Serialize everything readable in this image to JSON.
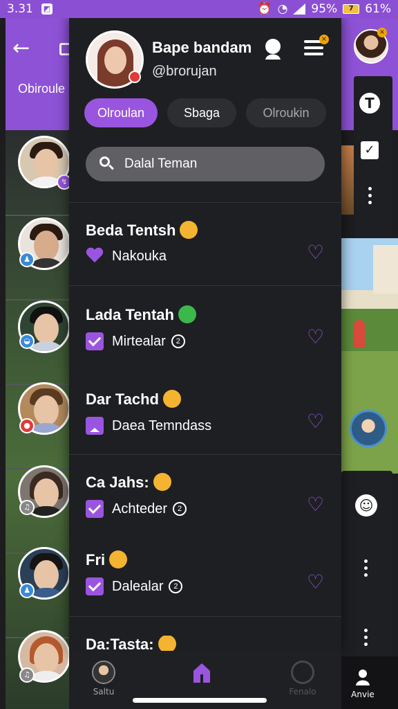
{
  "status": {
    "time": "3.31",
    "battery": "95%",
    "extra": "61%"
  },
  "background": {
    "tab_label": "Obiroule"
  },
  "profile": {
    "name": "Bape bandam",
    "handle": "@brorujan"
  },
  "tabs": [
    {
      "label": "Olroulan",
      "active": true
    },
    {
      "label": "Sbaga",
      "active": false
    },
    {
      "label": "Olroukin",
      "active": false
    }
  ],
  "search": {
    "placeholder": "Dalal Teman"
  },
  "contacts": [
    {
      "name": "Beda Tentsh",
      "status": "Nakouka",
      "indicator": "heart"
    },
    {
      "name": "Lada Tentah",
      "status": "Mirtealar",
      "indicator": "check",
      "extra": "2"
    },
    {
      "name": "Dar Tachd",
      "status": "Daea Temndass",
      "indicator": "up"
    },
    {
      "name": "Ca Jahs:",
      "status": "Achteder",
      "indicator": "check",
      "extra": "2"
    },
    {
      "name": "Fri",
      "status": "Dalealar",
      "indicator": "check",
      "extra": "2"
    },
    {
      "name": "Da:Tasta:",
      "status": "",
      "indicator": "none"
    }
  ],
  "bottom_nav": [
    {
      "label": "Saltu"
    },
    {
      "label": ""
    },
    {
      "label": "Fenalo"
    }
  ],
  "right_nav": {
    "label": "Anvie"
  },
  "colors": {
    "accent": "#9a55e0",
    "header": "#8e52d6",
    "panel": "#1e1f22"
  }
}
